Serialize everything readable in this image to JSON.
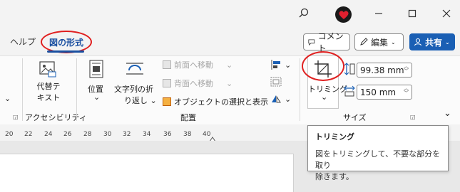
{
  "titlebar": {
    "avatar": "heart-avatar"
  },
  "tabs": {
    "help": "ヘルプ",
    "format": "図の形式"
  },
  "actions": {
    "comment": "コメント",
    "edit": "編集",
    "share": "共有"
  },
  "ribbon": {
    "alt_text": [
      "代替テ",
      "キスト"
    ],
    "accessibility_group": "アクセシビリティ",
    "position": "位置",
    "wrap": [
      "文字列の折",
      "り返し"
    ],
    "bring_forward": "前面へ移動",
    "send_backward": "背面へ移動",
    "selection_pane": "オブジェクトの選択と表示",
    "arrange_group": "配置",
    "crop": "トリミング",
    "height": "99.38 mm",
    "width": "150 mm",
    "size_group": "サイズ"
  },
  "ruler": {
    "ticks": [
      "20",
      "22",
      "24",
      "26",
      "28",
      "30",
      "32",
      "34",
      "36",
      "38",
      "40"
    ]
  },
  "tooltip": {
    "title": "トリミング",
    "body_line1": "図をトリミングして、不要な部分を取り",
    "body_line2": "除きます。"
  },
  "colors": {
    "accent": "#1a5fb4",
    "highlight_circle": "#e02020"
  }
}
